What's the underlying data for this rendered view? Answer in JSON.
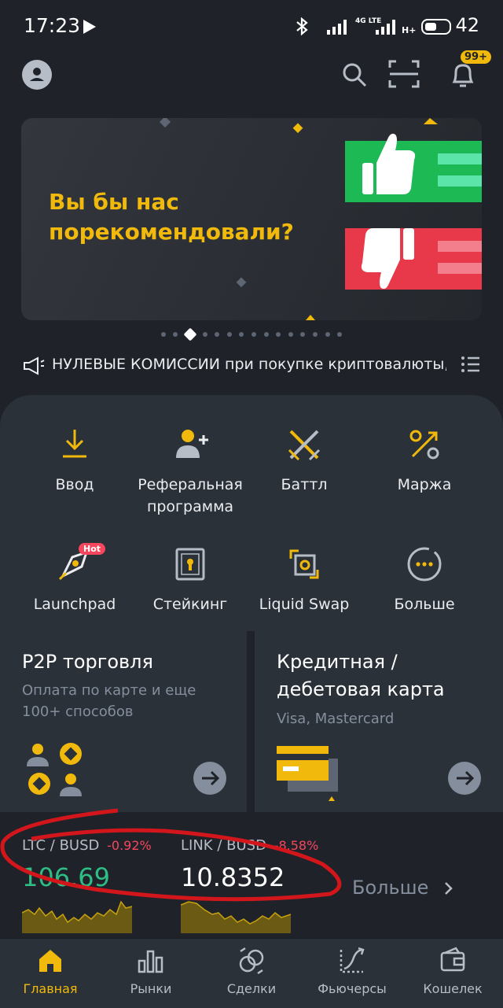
{
  "status_bar": {
    "time": "17:23",
    "battery": "42",
    "net1": "4G LTE",
    "net2": "H+"
  },
  "top_nav": {
    "notif_badge": "99+"
  },
  "banner": {
    "text_line1": "Вы бы нас",
    "text_line2": "порекомендовали?",
    "slide_count": 15,
    "active_slide": 3
  },
  "announcement": {
    "text": "НУЛЕВЫЕ КОМИССИИ при покупке криптовалюты, п"
  },
  "quick_actions": [
    {
      "label": "Ввод"
    },
    {
      "label": "Реферальная программа"
    },
    {
      "label": "Баттл"
    },
    {
      "label": "Маржа"
    },
    {
      "label": "Launchpad",
      "badge": "Hot"
    },
    {
      "label": "Стейкинг"
    },
    {
      "label": "Liquid Swap"
    },
    {
      "label": "Больше"
    }
  ],
  "cards": {
    "p2p": {
      "title": "P2P торговля",
      "subtitle": "Оплата по карте и еще 100+ способов"
    },
    "credit": {
      "title": "Кредитная / дебетовая карта",
      "subtitle": "Visa, Mastercard"
    }
  },
  "tickers": [
    {
      "pair": "LTC / BUSD",
      "change": "-0.92%",
      "price": "106.69"
    },
    {
      "pair": "LINK / BUSD",
      "change": "-8.58%",
      "price": "10.8352"
    }
  ],
  "tickers_more": "Больше",
  "bottom_nav": [
    {
      "label": "Главная",
      "active": true
    },
    {
      "label": "Рынки"
    },
    {
      "label": "Сделки"
    },
    {
      "label": "Фьючерсы"
    },
    {
      "label": "Кошелек"
    }
  ],
  "colors": {
    "accent": "#f0b90b",
    "green": "#2ebd85",
    "red": "#f6465d",
    "bg": "#1f2329",
    "panel": "#2b3139"
  }
}
